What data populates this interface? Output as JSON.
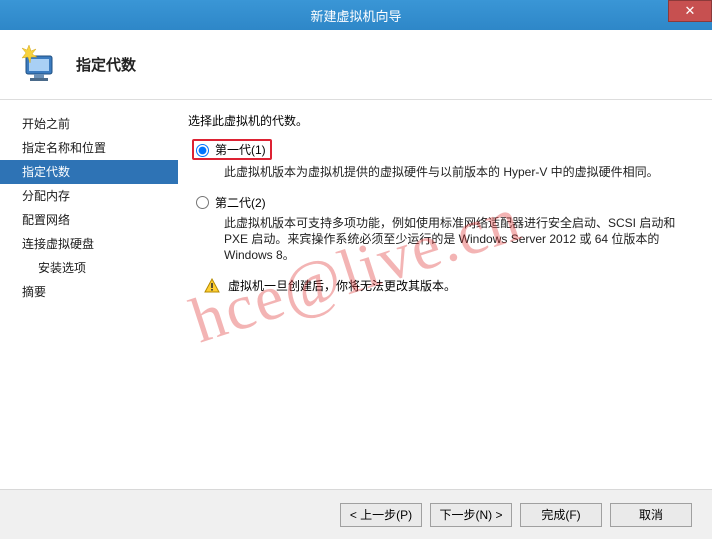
{
  "window": {
    "title": "新建虚拟机向导",
    "close_label": "✕"
  },
  "header": {
    "page_title": "指定代数"
  },
  "sidebar": {
    "items": [
      {
        "label": "开始之前",
        "active": false,
        "sub": false
      },
      {
        "label": "指定名称和位置",
        "active": false,
        "sub": false
      },
      {
        "label": "指定代数",
        "active": true,
        "sub": false
      },
      {
        "label": "分配内存",
        "active": false,
        "sub": false
      },
      {
        "label": "配置网络",
        "active": false,
        "sub": false
      },
      {
        "label": "连接虚拟硬盘",
        "active": false,
        "sub": false
      },
      {
        "label": "安装选项",
        "active": false,
        "sub": true
      },
      {
        "label": "摘要",
        "active": false,
        "sub": false
      }
    ]
  },
  "content": {
    "intro": "选择此虚拟机的代数。",
    "option1": {
      "label": "第一代(1)",
      "desc": "此虚拟机版本为虚拟机提供的虚拟硬件与以前版本的 Hyper-V 中的虚拟硬件相同。",
      "checked": true
    },
    "option2": {
      "label": "第二代(2)",
      "desc": "此虚拟机版本可支持多项功能，例如使用标准网络适配器进行安全启动、SCSI 启动和 PXE 启动。来宾操作系统必须至少运行的是 Windows Server 2012 或 64 位版本的 Windows 8。",
      "checked": false
    },
    "warning": "虚拟机一旦创建后，你将无法更改其版本。"
  },
  "watermark": "hce@live.cn",
  "footer": {
    "prev": "< 上一步(P)",
    "next": "下一步(N) >",
    "finish": "完成(F)",
    "cancel": "取消"
  }
}
